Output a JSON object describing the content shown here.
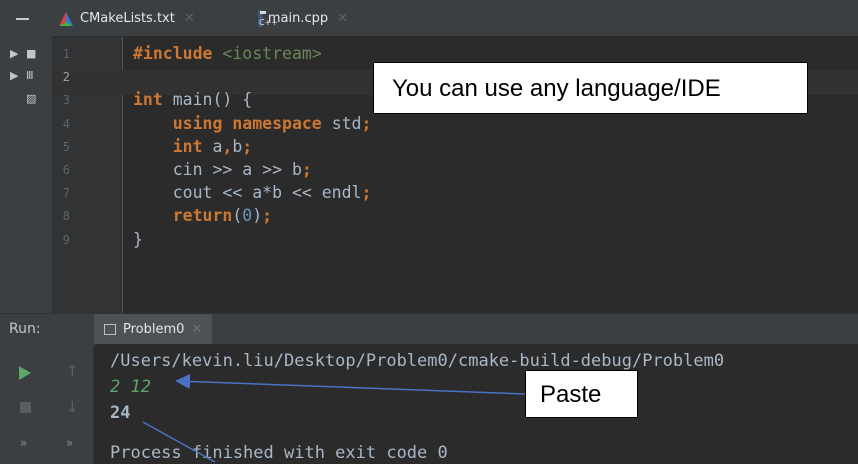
{
  "tabs": [
    {
      "label": "CMakeLists.txt",
      "icon": "cmake-triangle-icon"
    },
    {
      "label": "main.cpp",
      "icon": "cpp-file-icon"
    }
  ],
  "editor": {
    "line_numbers": [
      "1",
      "2",
      "3",
      "4",
      "5",
      "6",
      "7",
      "8",
      "9"
    ],
    "lines": [
      [
        {
          "t": "#include",
          "c": "kw"
        },
        {
          "t": " ",
          "c": "plain"
        },
        {
          "t": "<iostream>",
          "c": "str"
        }
      ],
      [],
      [
        {
          "t": "int",
          "c": "kw"
        },
        {
          "t": " main() {",
          "c": "plain"
        }
      ],
      [
        {
          "t": "    using namespace ",
          "c": "kw"
        },
        {
          "t": "std",
          "c": "plain"
        },
        {
          "t": ";",
          "c": "kw"
        }
      ],
      [
        {
          "t": "    int ",
          "c": "kw"
        },
        {
          "t": "a",
          "c": "plain"
        },
        {
          "t": ",",
          "c": "kw"
        },
        {
          "t": "b",
          "c": "plain"
        },
        {
          "t": ";",
          "c": "kw"
        }
      ],
      [
        {
          "t": "    cin >> a >> b",
          "c": "plain"
        },
        {
          "t": ";",
          "c": "kw"
        }
      ],
      [
        {
          "t": "    cout << a*b << endl",
          "c": "plain"
        },
        {
          "t": ";",
          "c": "kw"
        }
      ],
      [
        {
          "t": "    return",
          "c": "kw"
        },
        {
          "t": "(",
          "c": "plain"
        },
        {
          "t": "0",
          "c": "num"
        },
        {
          "t": ")",
          "c": "plain"
        },
        {
          "t": ";",
          "c": "kw"
        }
      ],
      [
        {
          "t": "}",
          "c": "plain"
        }
      ]
    ]
  },
  "run": {
    "label": "Run:",
    "tab_label": "Problem0",
    "output": {
      "path": "/Users/kevin.liu/Desktop/Problem0/cmake-build-debug/Problem0",
      "input": "2 12",
      "result": "24",
      "exit_message": "Process finished with exit code 0"
    }
  },
  "annotations": {
    "language_note": "You can use any language/IDE",
    "paste_note": "Paste"
  },
  "colors": {
    "keyword": "#cc7832",
    "string": "#6a8759",
    "number": "#6897bb",
    "input_text": "#59a869",
    "arrow": "#4a72c4"
  }
}
